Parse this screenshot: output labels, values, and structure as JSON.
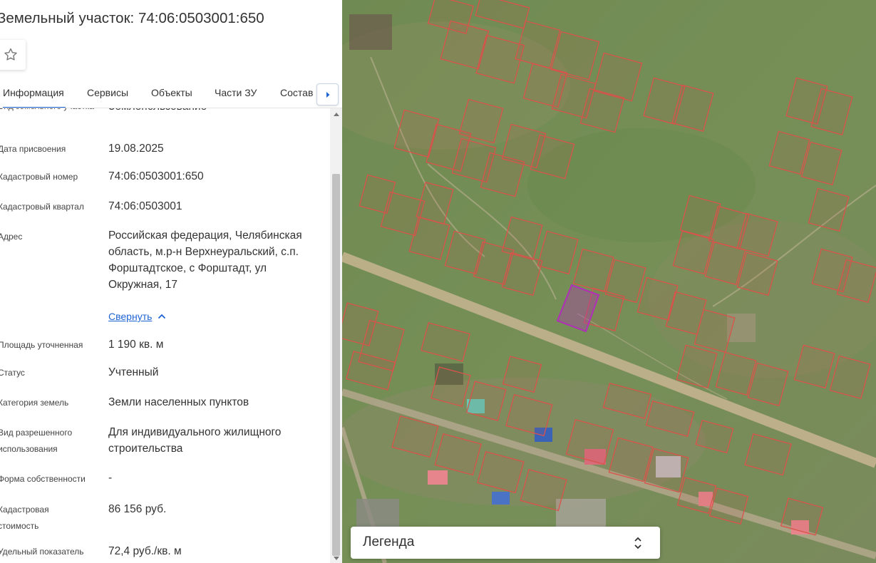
{
  "parcel": {
    "title": "Земельный участок: 74:06:0503001:650"
  },
  "icons": {
    "favorite": "star-outline-icon",
    "tab_next": "caret-right-icon",
    "collapse": "chevron-up-icon",
    "legend_toggle": "unfold-icon"
  },
  "tabs": [
    {
      "label": "Информация",
      "active": true
    },
    {
      "label": "Сервисы",
      "active": false
    },
    {
      "label": "Объекты",
      "active": false
    },
    {
      "label": "Части ЗУ",
      "active": false
    },
    {
      "label": "Состав",
      "active": false
    }
  ],
  "info": {
    "land_type_label": "Вид земельного участка",
    "land_type_value": "Землепользование",
    "assign_date_label": "Дата присвоения",
    "assign_date_value": "19.08.2025",
    "cad_number_label": "Кадастровый номер",
    "cad_number_value": "74:06:0503001:650",
    "cad_quarter_label": "Кадастровый квартал",
    "cad_quarter_value": "74:06:0503001",
    "address_label": "Адрес",
    "address_value": "Российская федерация, Челябинская область, м.р-н Верхнеуральский, с.п. Форштадтское, с Форштадт, ул Окружная, 17",
    "collapse_label": "Свернуть",
    "area_label": "Площадь уточненная",
    "area_value": "1 190 кв. м",
    "status_label": "Статус",
    "status_value": "Учтенный",
    "category_label": "Категория земель",
    "category_value": "Земли населенных пунктов",
    "permitted_use_label": "Вид разрешенного использования",
    "permitted_use_value": "Для индивидуального жилищного строительства",
    "ownership_label": "Форма собственности",
    "ownership_value": "-",
    "cad_value_label": "Кадастровая стоимость",
    "cad_value_value": "86 156 руб.",
    "specific_label": "Удельный показатель",
    "specific_value": "72,4 руб./кв. м"
  },
  "legend": {
    "label": "Легенда"
  },
  "colors": {
    "accent": "#1f64d4",
    "parcel_outline": "#d9534a",
    "selected_parcel": "#b12fb8"
  }
}
